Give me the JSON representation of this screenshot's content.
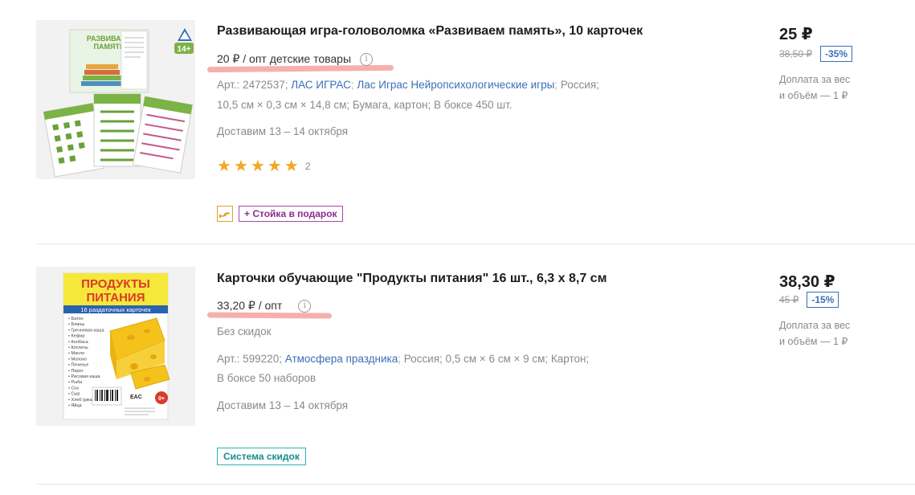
{
  "products": [
    {
      "title": "Развивающая игра-головоломка «Развиваем память», 10 карточек",
      "wholesale_price": "20 ₽ / опт детские товары",
      "meta_line1": {
        "article": "Арт.: 2472537;",
        "brand": "ЛАС ИГРАС",
        "series": "Лас Играс Нейропсихологические игры",
        "country": "Россия;"
      },
      "meta_line2": "10,5 см × 0,3 см × 14,8 см;  Бумага, картон;  В боксе 450 шт.",
      "delivery": "Доставим 13 – 14 октября",
      "rating": {
        "stars": 5,
        "count": "2"
      },
      "badge": "+ Стойка в подарок",
      "price": "25 ₽",
      "old_price": "38,50 ₽",
      "discount": "-35%",
      "surcharge_line1": "Доплата за вес",
      "surcharge_line2": "и объём — 1 ₽",
      "image": {
        "title_line1": "РАЗВИВАЕМ",
        "title_line2": "ПАМЯТЬ",
        "age": "14+",
        "logo": "ЛАС ИГРАС"
      }
    },
    {
      "title": "Карточки обучающие \"Продукты питания\" 16 шт., 6,3 х 8,7 см",
      "wholesale_price": "33,20 ₽ / опт",
      "no_discount": "Без скидок",
      "meta_line1": {
        "article": "Арт.: 599220;",
        "brand": "Атмосфера праздника",
        "rest": "Россия;  0,5 см × 6 см × 9 см;  Картон;"
      },
      "meta_line2": "В боксе 50 наборов",
      "delivery": "Доставим 13 – 14 октября",
      "badge": "Система скидок",
      "price": "38,30 ₽",
      "old_price": "45 ₽",
      "discount": "-15%",
      "surcharge_line1": "Доплата за вес",
      "surcharge_line2": "и объём — 1 ₽",
      "image": {
        "title_line1": "ПРОДУКТЫ",
        "title_line2": "ПИТАНИЯ",
        "subtitle": "16 раздаточных карточек",
        "age": "0+",
        "eac": "EAC",
        "items": [
          "Батон",
          "Блины",
          "Гречневая каша",
          "Кефир",
          "Колбаса",
          "Котлеты",
          "Масло",
          "Молоко",
          "Печенье",
          "Пирог",
          "Рисовая каша",
          "Рыба",
          "Сок",
          "Сыр",
          "Хлеб (ржаной)",
          "Яйца"
        ]
      }
    }
  ],
  "colors": {
    "star": "#f5a623",
    "link": "#3a6fb8",
    "gift_badge": "#8b2d8b",
    "discount_system": "#168c8c",
    "highlight": "#f4a7a4"
  }
}
